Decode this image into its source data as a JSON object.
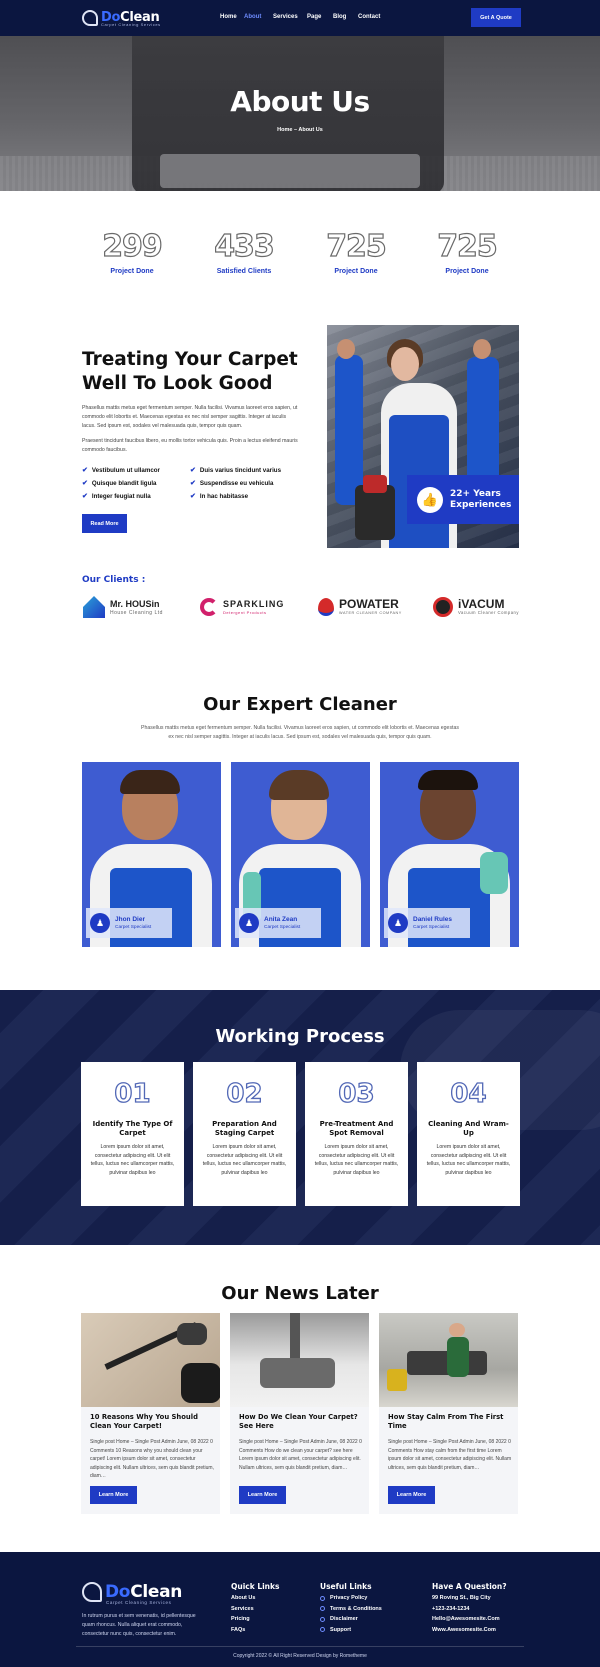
{
  "brand": {
    "name_part1": "Do",
    "name_part2": "Clean",
    "tagline": "Carpet Cleaning Services"
  },
  "nav": {
    "items": [
      "Home",
      "About",
      "Services",
      "Page",
      "Blog",
      "Contact"
    ],
    "active": "About",
    "cta": "Get A Quote"
  },
  "hero": {
    "title": "About Us",
    "breadcrumb": "Home – About Us"
  },
  "stats": [
    {
      "number": "299",
      "label": "Project Done"
    },
    {
      "number": "433",
      "label": "Satisfied Clients"
    },
    {
      "number": "725",
      "label": "Project Done"
    },
    {
      "number": "725",
      "label": "Project Done"
    }
  ],
  "about": {
    "heading_line1": "Treating Your Carpet",
    "heading_line2": "Well To Look Good",
    "para1": "Phasellus mattis metus eget fermentum semper. Nulla facilisi. Vivamus laoreet eros sapien, ut commodo elit lobortis et. Maecenas egestas ex nec nisl semper sagittis. Integer at iaculis lacus. Sed ipsum est, sodales vel malesuada quis, tempor quis quam.",
    "para2": "Praesent tincidunt faucibus libero, eu mollis tortor vehicula quis. Proin a lectus eleifend mauris commodo faucibus.",
    "checks": [
      "Vestibulum ut ullamcor",
      "Duis varius tincidunt varius",
      "Quisque blandit ligula",
      "Suspendisse eu vehicula",
      "Integer feugiat nulla",
      "In hac habitasse"
    ],
    "button": "Read More",
    "experience": "22+ Years Experiences"
  },
  "clients": {
    "heading": "Our Clients :",
    "items": [
      {
        "name": "Mr. HOUSin",
        "sub": "House Cleaning Ltd"
      },
      {
        "name": "SPARKLING",
        "sub": "Detergent Products"
      },
      {
        "name": "POWATER",
        "sub": "WATER CLEANER COMPANY"
      },
      {
        "name": "iVACUM",
        "sub": "Vacuum Cleaner Company"
      }
    ]
  },
  "team": {
    "heading": "Our Expert Cleaner",
    "intro": "Phasellus mattis metus eget fermentum semper. Nulla facilisi. Vivamus laoreet eros sapien, ut commodo elit lobortis et. Maecenas egestas ex nec nisl semper sagittis. Integer at iaculis lacus. Sed ipsum est, sodales vel malesuada quis, tempor quis quam.",
    "members": [
      {
        "name": "Jhon Dier",
        "role": "Carpet Specialist"
      },
      {
        "name": "Anita Zean",
        "role": "Carpet Specialist"
      },
      {
        "name": "Daniel Rules",
        "role": "Carpet Specialist"
      }
    ]
  },
  "process": {
    "heading": "Working Process",
    "steps": [
      {
        "num": "01",
        "title": "Identify The Type Of Carpet",
        "desc": "Lorem ipsum dolor sit amet, consectetur adipiscing elit. Ut elit tellus, luctus nec ullamcorper mattis, pulvinar dapibus leo"
      },
      {
        "num": "02",
        "title": "Preparation And Staging Carpet",
        "desc": "Lorem ipsum dolor sit amet, consectetur adipiscing elit. Ut elit tellus, luctus nec ullamcorper mattis, pulvinar dapibus leo"
      },
      {
        "num": "03",
        "title": "Pre-Treatment And Spot Removal",
        "desc": "Lorem ipsum dolor sit amet, consectetur adipiscing elit. Ut elit tellus, luctus nec ullamcorper mattis, pulvinar dapibus leo"
      },
      {
        "num": "04",
        "title": "Cleaning And Wram-Up",
        "desc": "Lorem ipsum dolor sit amet, consectetur adipiscing elit. Ut elit tellus, luctus nec ullamcorper mattis, pulvinar dapibus leo"
      }
    ]
  },
  "news": {
    "heading": "Our News Later",
    "posts": [
      {
        "title": "10 Reasons Why You Should Clean Your Carpet!",
        "excerpt": "Single post Home – Single Post Admin June, 08 2022 0 Comments 10 Reasons why you should clean your carpet! Lorem ipsum dolor sit amet, consectetur adipiscing elit. Nullam ultrices, sem quis blandit pretium, diam…",
        "button": "Learn More"
      },
      {
        "title": "How Do We Clean Your Carpet? See Here",
        "excerpt": "Single post Home – Single Post Admin June, 08 2022 0 Comments How do we clean your carpet? see here Lorem ipsum dolor sit amet, consectetur adipiscing elit. Nullam ultrices, sem quis blandit pretium, diam…",
        "button": "Learn More"
      },
      {
        "title": "How Stay Calm From The First Time",
        "excerpt": "Single post Home – Single Post Admin June, 08 2022 0 Comments How stay calm from the first time Lorem ipsum dolor sit amet, consectetur adipiscing elit. Nullam ultrices, sem quis blandit pretium, diam…",
        "button": "Learn More"
      }
    ]
  },
  "footer": {
    "about": "In rutrum purus et sem venenatis, id pellentesque quam rhoncus. Nulla aliquet erat commodo, consectetur nunc quis, consectetur enim.",
    "quick_links_heading": "Quick Links",
    "quick_links": [
      "About Us",
      "Services",
      "Pricing",
      "FAQs"
    ],
    "useful_links_heading": "Useful Links",
    "useful_links": [
      "Privacy Policy",
      "Terms & Conditions",
      "Disclaimer",
      "Support"
    ],
    "contact_heading": "Have A Question?",
    "contact": [
      "99 Roving St., Big City",
      "+123-234-1234",
      "Hello@Awesomesite.Com",
      "Www.Awesomesite.Com"
    ],
    "copyright": "Copyright 2022 © All Right Reserved Design by Rometheme"
  },
  "colors": {
    "navy": "#0b1640",
    "accent": "#1f3bc4",
    "team_bg": "#3e5cd1"
  }
}
